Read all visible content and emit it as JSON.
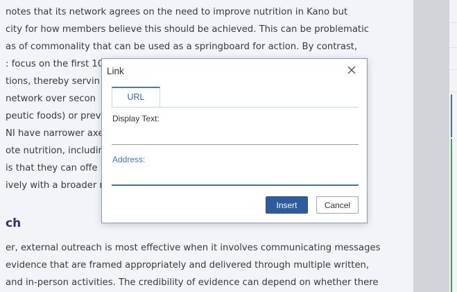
{
  "document": {
    "lines": [
      "notes that its network agrees on the need to improve nutrition in Kano but",
      "city for how members believe this should be achieved. This can be problematic",
      "as of commonality that can be used as a springboard for action. By contrast,",
      ": focus on the first 10",
      "tions, thereby servin",
      "network over secon",
      "peutic foods) or prev",
      "NI have narrower axe",
      "ote nutrition, includin",
      "is that they can offe",
      "ively with a broader r",
      "er, external outreach is most effective when it involves communicating messages",
      "evidence that are framed appropriately and delivered through multiple written,",
      "and in-person activities. The credibility of evidence can depend on whether there"
    ],
    "heading": "ch"
  },
  "dialog": {
    "title": "Link",
    "close_icon": "close-icon",
    "tab_url_label": "URL",
    "display_text_label": "Display Text:",
    "display_text_value": "",
    "address_label": "Address:",
    "address_value": "",
    "insert_label": "Insert",
    "cancel_label": "Cancel"
  },
  "colors": {
    "accent": "#2e5a9e",
    "heading": "#3a2a7a",
    "link_blue": "#3a74c4"
  }
}
